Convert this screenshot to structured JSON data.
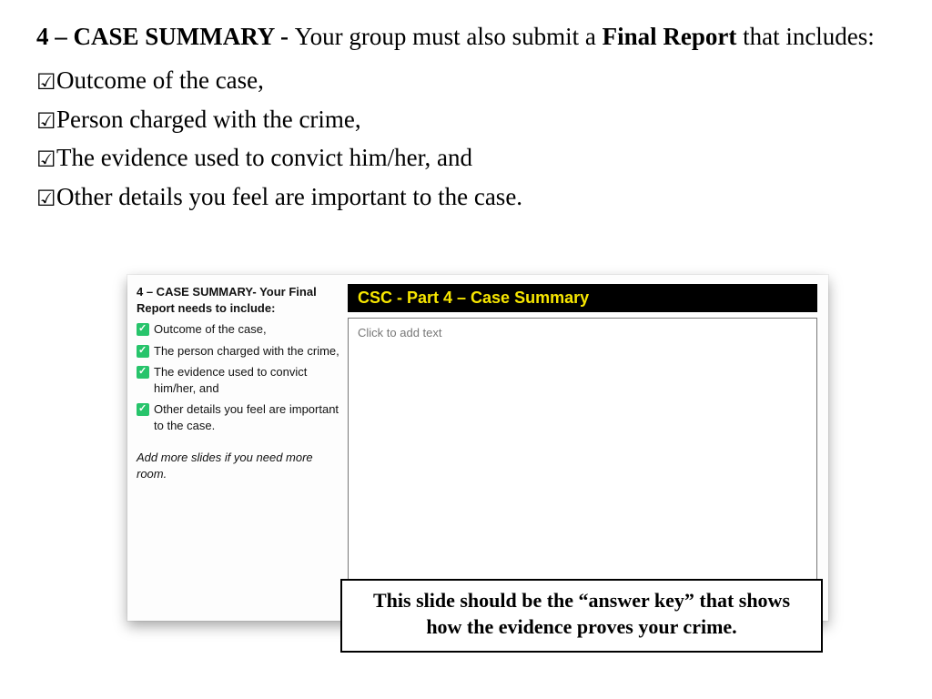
{
  "heading": {
    "prefix_bold": "4 – CASE SUMMARY - ",
    "mid_plain": "Your group must also submit a ",
    "mid_bold": "Final Report",
    "suffix_plain": " that includes:"
  },
  "checklist": [
    "Outcome of the case,",
    "Person charged with the crime,",
    "The evidence used to convict him/her, and",
    "Other details you feel are important to the case."
  ],
  "slide": {
    "left_title": "4 – CASE SUMMARY- Your Final Report needs to include:",
    "left_items": [
      "Outcome of the case,",
      "The person charged with the crime,",
      "The evidence used to convict him/her, and",
      "Other details you feel are important to the case."
    ],
    "left_note": "Add more slides if you need more room.",
    "bar_title": "CSC - Part 4 – Case Summary",
    "body_placeholder": "Click to add text"
  },
  "callout": "This slide should be the “answer key” that shows how the evidence proves your crime."
}
